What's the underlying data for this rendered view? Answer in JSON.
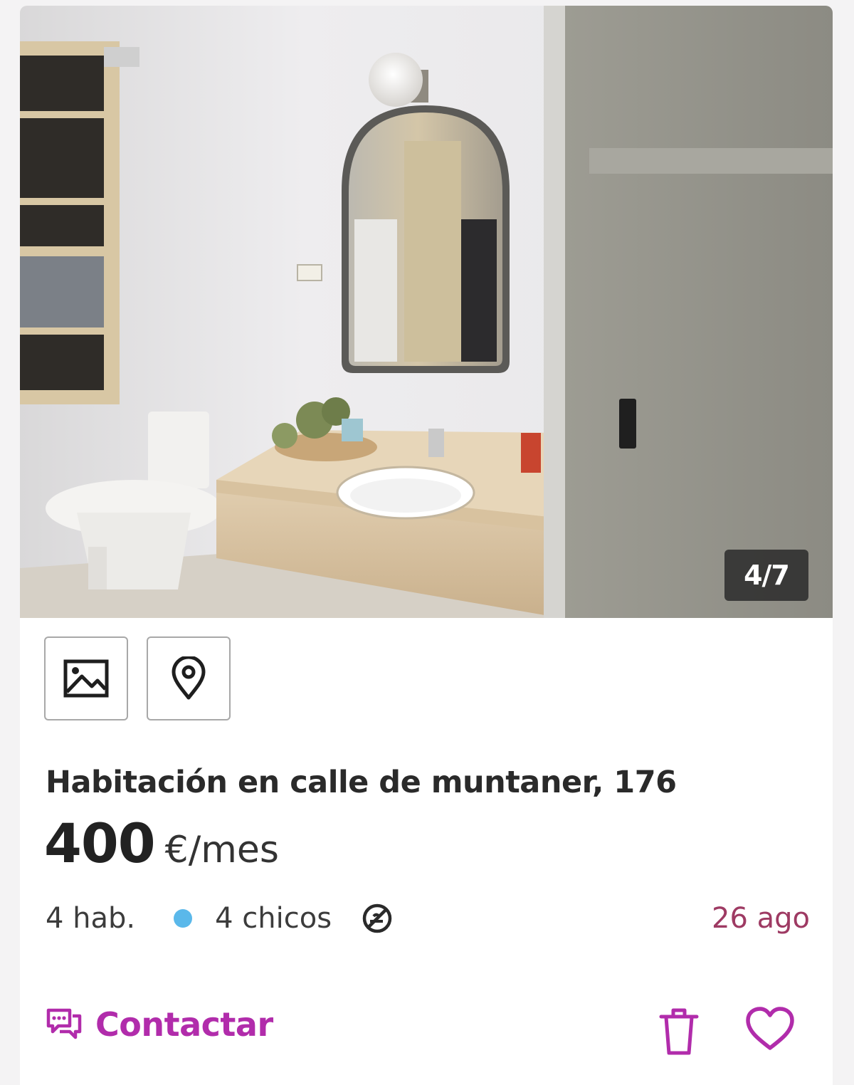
{
  "listing": {
    "photo_counter": "4/7",
    "title": "Habitación en calle de muntaner, 176",
    "price_amount": "400",
    "price_unit": "€/mes",
    "rooms": "4 hab.",
    "tenants": "4 chicos",
    "date": "26 ago"
  },
  "actions": {
    "contact_label": "Contactar",
    "icons": {
      "photos": "image-icon",
      "map": "map-pin-icon",
      "no_smoking": "no-smoking-icon",
      "contact": "chat-icon",
      "discard": "trash-icon",
      "favorite": "heart-icon"
    }
  },
  "colors": {
    "accent": "#b12cab",
    "date": "#9e3a63",
    "tenants_dot": "#5ab8ea"
  }
}
